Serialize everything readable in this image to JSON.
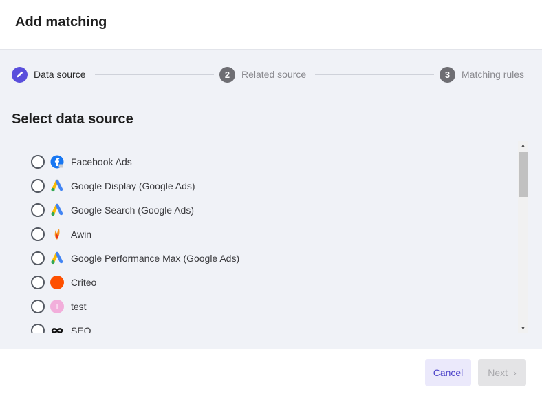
{
  "dialog": {
    "title": "Add matching"
  },
  "stepper": {
    "steps": [
      {
        "number": "",
        "label": "Data source",
        "state": "active",
        "icon": "pencil-icon"
      },
      {
        "number": "2",
        "label": "Related source",
        "state": "inactive"
      },
      {
        "number": "3",
        "label": "Matching rules",
        "state": "inactive"
      }
    ]
  },
  "section": {
    "title": "Select data source"
  },
  "sources": [
    {
      "label": "Facebook Ads",
      "icon": "facebook-icon",
      "selected": false
    },
    {
      "label": "Google Display (Google Ads)",
      "icon": "google-ads-icon",
      "selected": false
    },
    {
      "label": "Google Search (Google Ads)",
      "icon": "google-ads-icon",
      "selected": false
    },
    {
      "label": "Awin",
      "icon": "awin-icon",
      "selected": false
    },
    {
      "label": "Google Performance Max (Google Ads)",
      "icon": "google-ads-icon",
      "selected": false
    },
    {
      "label": "Criteo",
      "icon": "criteo-icon",
      "selected": false
    },
    {
      "label": "test",
      "icon": "avatar-t-icon",
      "avatar_letter": "T",
      "selected": false
    },
    {
      "label": "SEO",
      "icon": "infinity-icon",
      "selected": false
    }
  ],
  "footer": {
    "cancel_label": "Cancel",
    "next_label": "Next",
    "next_chevron": "›"
  },
  "colors": {
    "accent": "#5a4fdc",
    "body_bg": "#f0f2f7",
    "facebook": "#1877f2",
    "criteo": "#fe5000",
    "test_avatar": "#f2aedb"
  }
}
